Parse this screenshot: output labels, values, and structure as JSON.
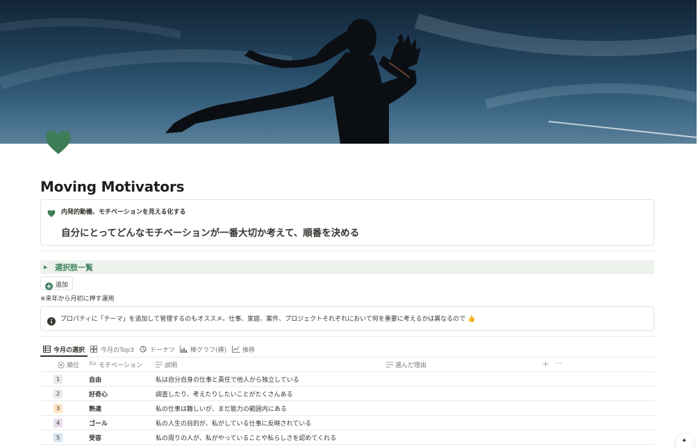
{
  "page": {
    "title": "Moving Motivators",
    "icon": "green-heart-icon"
  },
  "callout_top": {
    "icon": "green-heart-icon",
    "subtitle": "内発的動機、モチベーションを見える化する",
    "heading": "自分にとってどんなモチベーションが一番大切か考えて、順番を決める"
  },
  "toggle": {
    "label": "選択肢一覧",
    "color": "#448361",
    "background": "#edf3ec"
  },
  "add_button": {
    "label": "追加"
  },
  "note": "※来年から月初に押す運用",
  "info_callout": {
    "icon": "info-icon",
    "text": "プロパティに「テーマ」を追加して管理するのもオススメ。仕事、家庭、案件、プロジェクトそれぞれにおいて何を重要に考えるかは異なるので 👍"
  },
  "tabs": [
    {
      "label": "今月の選択",
      "icon": "table-icon",
      "active": true
    },
    {
      "label": "今月のTop3",
      "icon": "gallery-icon",
      "active": false
    },
    {
      "label": "ドーナツ",
      "icon": "donut-chart-icon",
      "active": false
    },
    {
      "label": "棒グラフ(横)",
      "icon": "bar-chart-icon",
      "active": false
    },
    {
      "label": "推移",
      "icon": "line-chart-icon",
      "active": false
    }
  ],
  "table": {
    "columns": [
      {
        "label": "順位",
        "icon": "rank-icon"
      },
      {
        "label": "モチベーション",
        "icon": "text-property-icon"
      },
      {
        "label": "説明",
        "icon": "text-lines-icon"
      },
      {
        "label": "選んだ理由",
        "icon": "text-lines-icon"
      }
    ],
    "add_column": "+",
    "more": "···",
    "rows": [
      {
        "rank": "1",
        "rank_color": "#e9e9e7",
        "motivation": "自由",
        "description": "私は自分自身の仕事と責任で他人から独立している"
      },
      {
        "rank": "2",
        "rank_color": "#e9e9e7",
        "motivation": "好奇心",
        "description": "調査したり、考えたりしたいことがたくさんある"
      },
      {
        "rank": "3",
        "rank_color": "#fbe3c4",
        "motivation": "熟達",
        "description": "私の仕事は難しいが、まだ能力の範囲内にある"
      },
      {
        "rank": "4",
        "rank_color": "#e8deee",
        "motivation": "ゴール",
        "description": "私の人生の目的が、私がしている仕事に反映されている"
      },
      {
        "rank": "5",
        "rank_color": "#d3e5ef",
        "motivation": "受容",
        "description": "私の周りの人が、私がやっていることや私らしさを認めてくれる"
      }
    ]
  },
  "help_button": {
    "label": "✦"
  },
  "colors": {
    "accent_green": "#448361",
    "heart": "#3e7d57",
    "text": "#37352f",
    "muted": "#787774"
  }
}
